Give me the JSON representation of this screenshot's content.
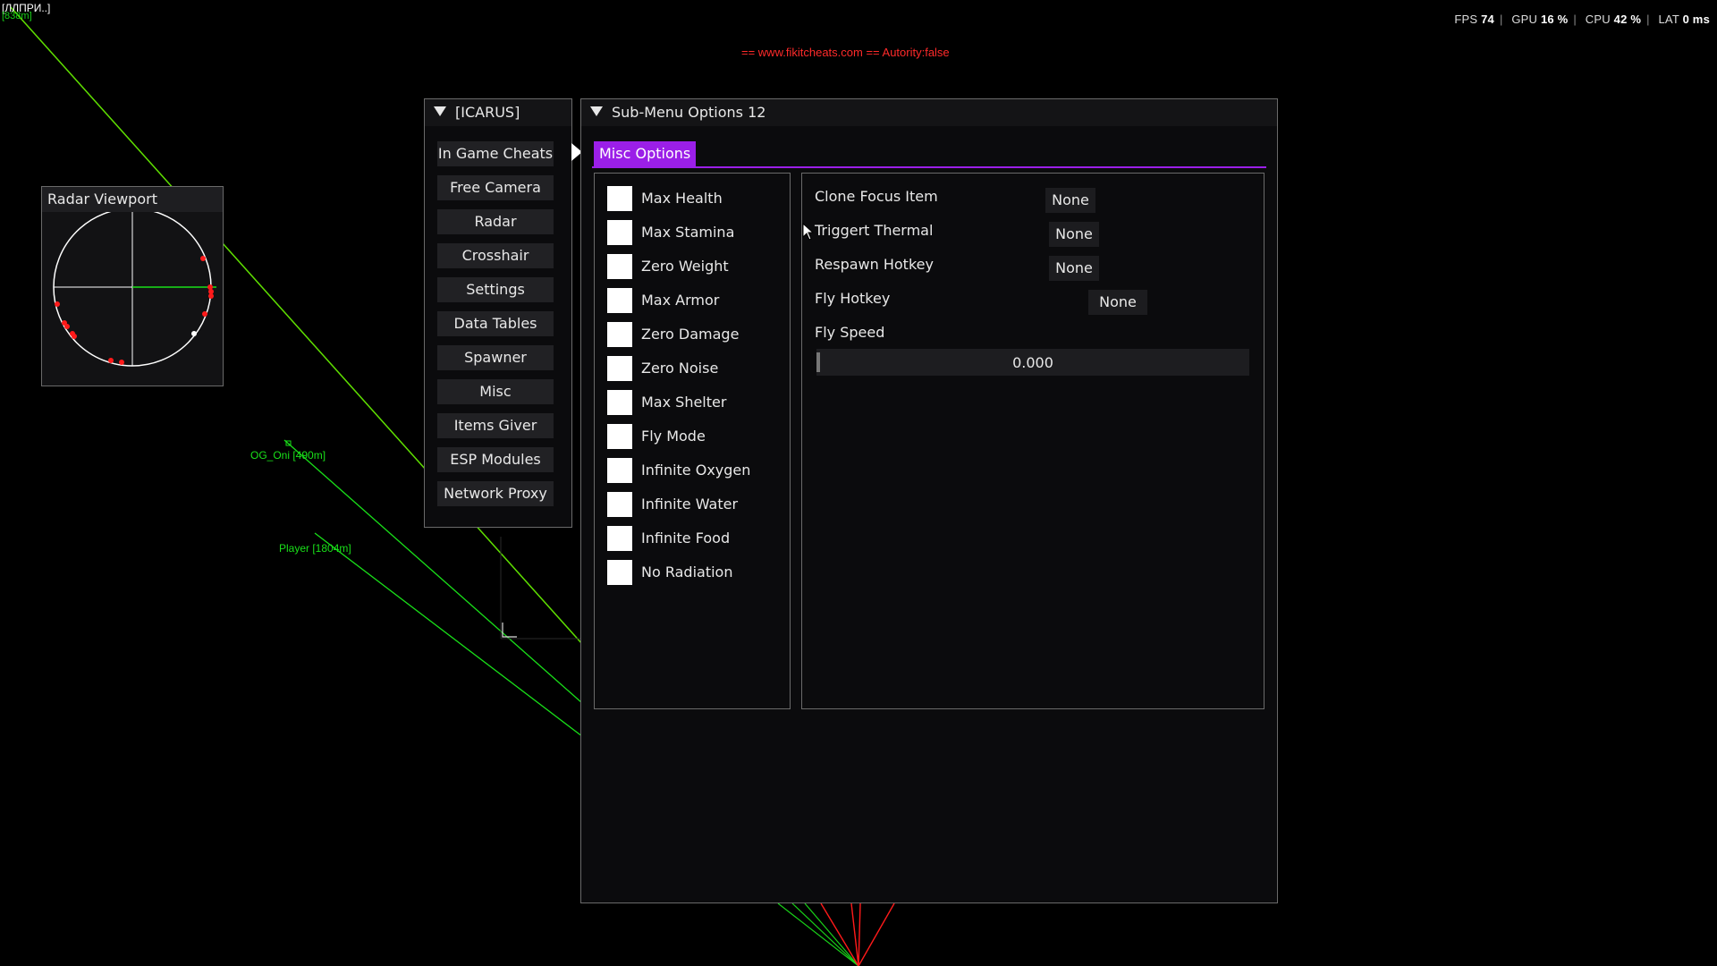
{
  "overlay": {
    "top_left_label": "[ЛЛПРИ..]",
    "top_left_green": "[838m]",
    "watermark": "== www.fikitcheats.com == Autority:false",
    "stats": {
      "fps_label": "FPS",
      "fps": "74",
      "gpu_label": "GPU",
      "gpu": "16 %",
      "cpu_label": "CPU",
      "cpu": "42 %",
      "lat_label": "LAT",
      "lat": "0 ms"
    },
    "esp": [
      {
        "text": "OG_Oni [490m]"
      },
      {
        "text": "Player [1804m]"
      }
    ],
    "colors": {
      "esp_green": "#19e019",
      "enemy_red": "#ff1a1a",
      "accent_purple": "#9b1fe8"
    }
  },
  "radar": {
    "title": "Radar Viewport"
  },
  "main_menu": {
    "title": "[ICARUS]",
    "items": [
      {
        "label": "In Game Cheats"
      },
      {
        "label": "Free Camera"
      },
      {
        "label": "Radar"
      },
      {
        "label": "Crosshair"
      },
      {
        "label": "Settings"
      },
      {
        "label": "Data Tables"
      },
      {
        "label": "Spawner"
      },
      {
        "label": "Misc"
      },
      {
        "label": "Items Giver"
      },
      {
        "label": "ESP Modules"
      },
      {
        "label": "Network Proxy"
      }
    ]
  },
  "sub_menu": {
    "title": "Sub-Menu Options 12",
    "tab": "Misc Options",
    "checkboxes": [
      {
        "label": "Max Health",
        "checked": false
      },
      {
        "label": "Max Stamina",
        "checked": false
      },
      {
        "label": "Zero Weight",
        "checked": false
      },
      {
        "label": "Max Armor",
        "checked": false
      },
      {
        "label": "Zero Damage",
        "checked": false
      },
      {
        "label": "Zero Noise",
        "checked": false
      },
      {
        "label": "Max Shelter",
        "checked": false
      },
      {
        "label": "Fly Mode",
        "checked": false
      },
      {
        "label": "Infinite Oxygen",
        "checked": false
      },
      {
        "label": "Infinite Water",
        "checked": false
      },
      {
        "label": "Infinite Food",
        "checked": false
      },
      {
        "label": "No Radiation",
        "checked": false
      }
    ],
    "options": [
      {
        "label": "Clone Focus Item",
        "value": "None"
      },
      {
        "label": "Triggert Thermal",
        "value": "None"
      },
      {
        "label": "Respawn Hotkey",
        "value": "None"
      },
      {
        "label": "Fly Hotkey",
        "value": "None"
      }
    ],
    "fly_speed": {
      "label": "Fly Speed",
      "value": "0.000"
    }
  }
}
